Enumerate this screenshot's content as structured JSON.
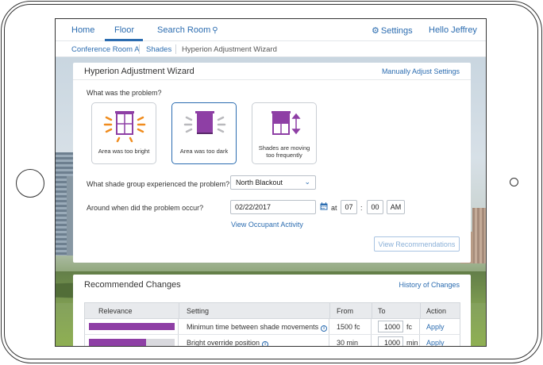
{
  "nav": {
    "home": "Home",
    "floor": "Floor",
    "search": "Search Room",
    "settings": "Settings",
    "user": "Hello Jeffrey"
  },
  "breadcrumb": {
    "items": [
      "Conference Room A",
      "Shades",
      "Hyperion Adjustment Wizard"
    ]
  },
  "wizard": {
    "title": "Hyperion Adjustment Wizard",
    "manual_link": "Manually Adjust Settings",
    "question_problem": "What was the problem?",
    "options": [
      {
        "label": "Area was too bright",
        "icon": "shade-bright-icon",
        "selected": false
      },
      {
        "label": "Area was too dark",
        "icon": "shade-dark-icon",
        "selected": true
      },
      {
        "label_line1": "Shades are moving",
        "label_line2": "too frequently",
        "icon": "shade-moving-icon",
        "selected": false
      }
    ],
    "question_group": "What shade group experienced the problem?",
    "group_value": "North Blackout",
    "question_when": "Around when did the problem occur?",
    "date_value": "02/22/2017",
    "at_label": "at",
    "hour": "07",
    "minute": "00",
    "ampm": "AM",
    "occupant_link": "View Occupant Activity",
    "recommend_button": "View Recommendations"
  },
  "changes": {
    "title": "Recommended Changes",
    "history_link": "History of Changes",
    "columns": [
      "Relevance",
      "Setting",
      "From",
      "To",
      "Action"
    ],
    "rows": [
      {
        "relevance": 1.0,
        "setting": "Minimun time between shade movements",
        "from": "1500 fc",
        "to": "1000",
        "unit": "fc",
        "action": "Apply"
      },
      {
        "relevance": 0.67,
        "setting": "Bright override position",
        "from": "30 min",
        "to": "1000",
        "unit": "min",
        "action": "Apply"
      }
    ]
  },
  "colors": {
    "accent": "#2b6cb0",
    "shade_purple": "#8e3fa5",
    "orange": "#f08c1e"
  }
}
